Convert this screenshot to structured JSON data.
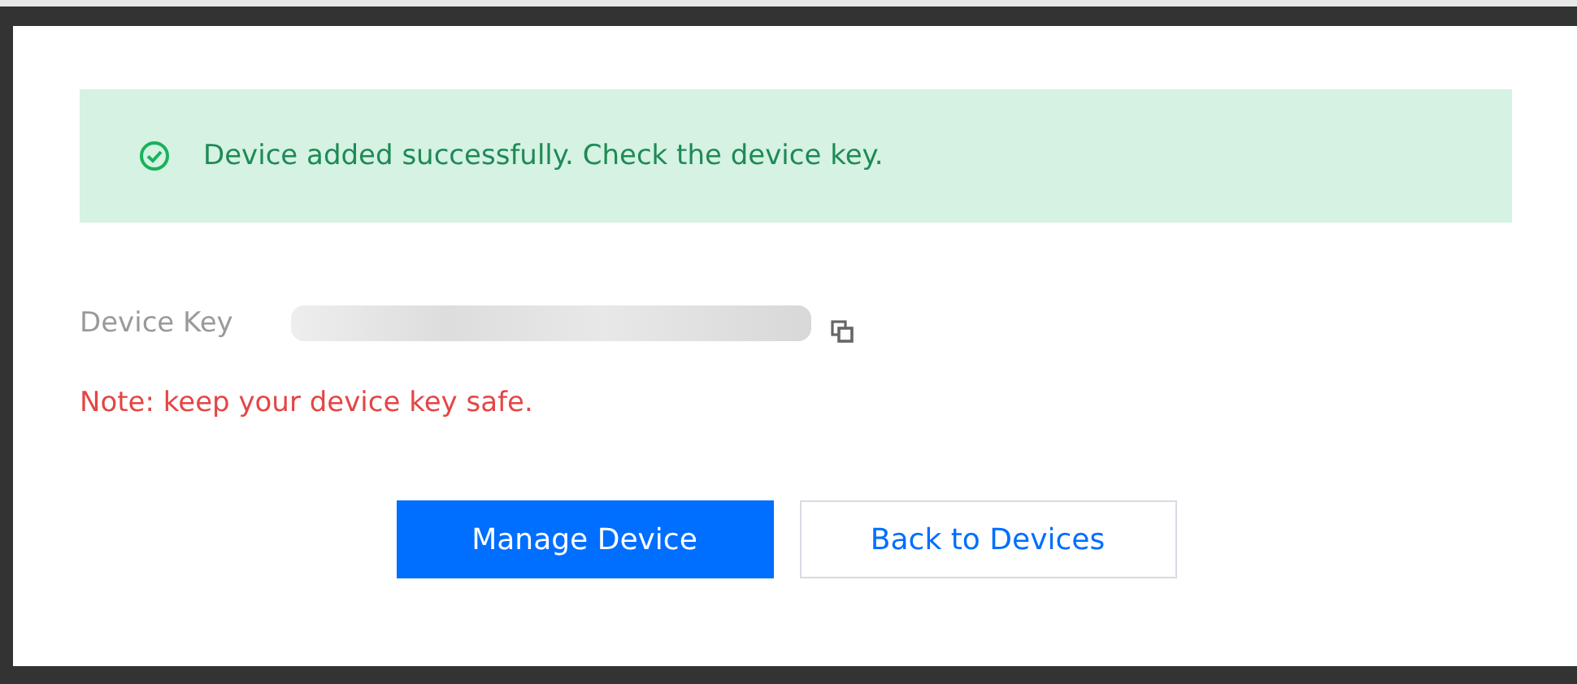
{
  "alert": {
    "kind": "success",
    "message": "Device added successfully. Check the device key."
  },
  "device_key": {
    "label": "Device Key"
  },
  "note": "Note: keep your device key safe.",
  "buttons": [
    {
      "label": "Manage Device",
      "kind": "primary"
    },
    {
      "label": "Back to Devices",
      "kind": "secondary"
    }
  ]
}
